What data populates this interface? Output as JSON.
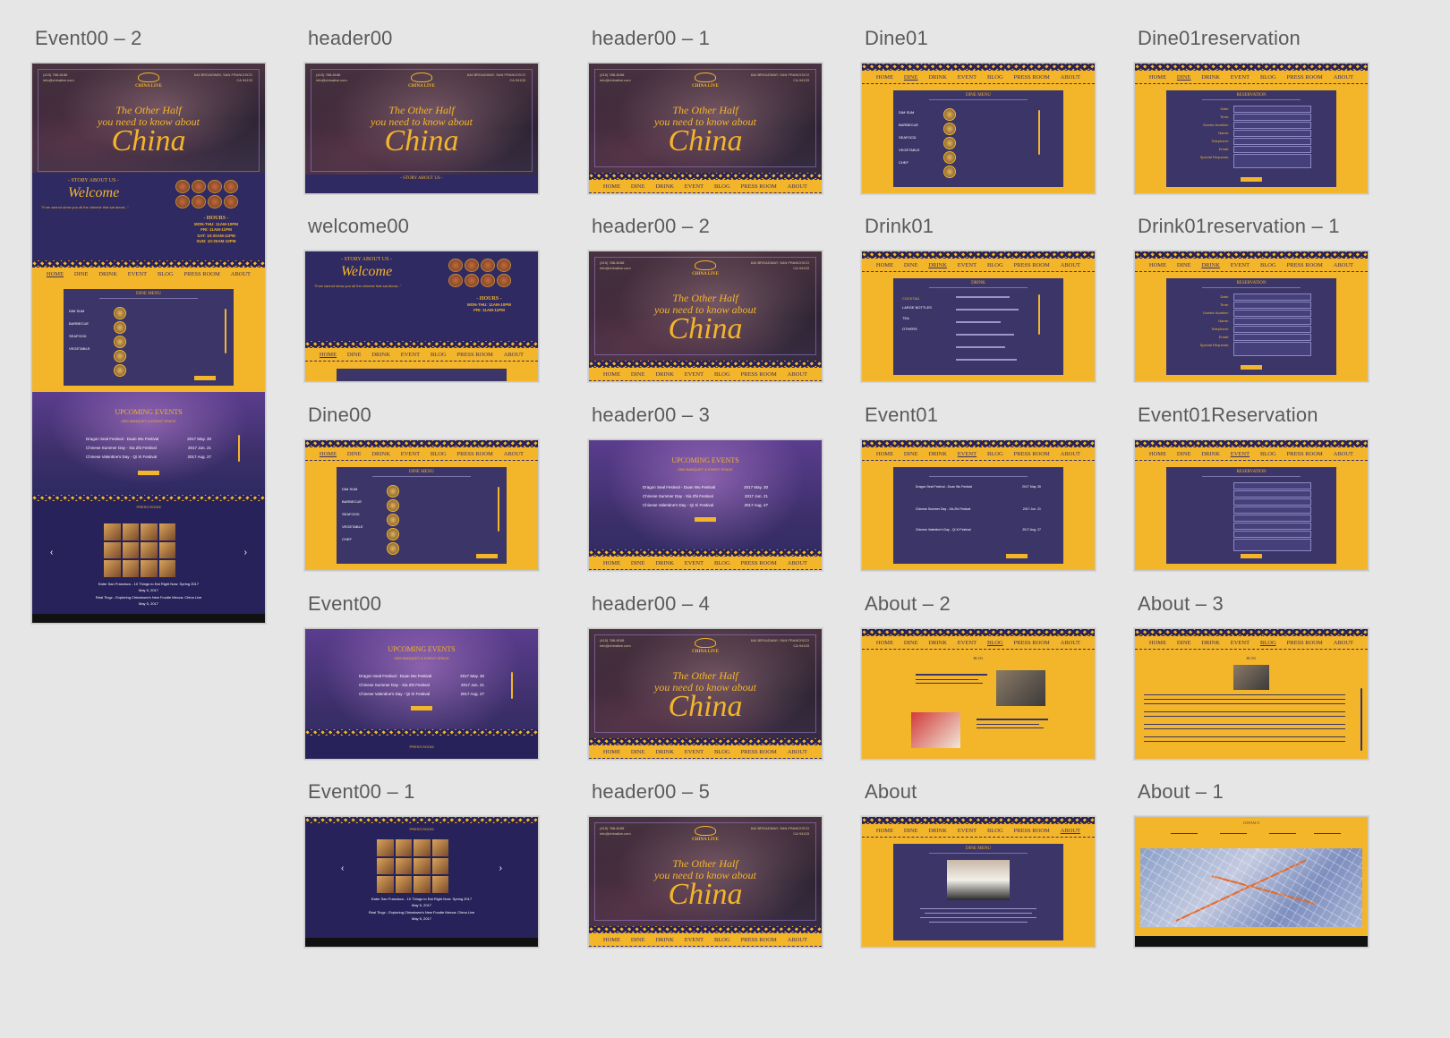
{
  "artboards": {
    "event00_2": "Event00 – 2",
    "header00": "header00",
    "header00_1": "header00 – 1",
    "dine01": "Dine01",
    "dine01reservation": "Dine01reservation",
    "welcome00": "welcome00",
    "header00_2": "header00 – 2",
    "drink01": "Drink01",
    "drink01reservation_1": "Drink01reservation – 1",
    "dine00": "Dine00",
    "header00_3": "header00 – 3",
    "event01": "Event01",
    "event01reservation": "Event01Reservation",
    "event00": "Event00",
    "header00_4": "header00 – 4",
    "about_2": "About – 2",
    "about_3": "About – 3",
    "event00_1": "Event00 – 1",
    "header00_5": "header00 – 5",
    "about": "About",
    "about_1": "About – 1"
  },
  "nav": [
    "HOME",
    "DINE",
    "DRINK",
    "EVENT",
    "BLOG",
    "PRESS ROOM",
    "ABOUT"
  ],
  "hero": {
    "brand": "CHINA LIVE",
    "tagline1": "The Other Half",
    "tagline2": "you need to know about",
    "china": "China",
    "contact_left1": "(415) 788-8188",
    "contact_left2": "info@chinalive.com",
    "contact_right1": "644 BROADWAY, SAN FRANCISCO",
    "contact_right2": "CA 94133"
  },
  "welcome": {
    "story": "- STORY ABOUT US -",
    "title": "Welcome",
    "para": "\"If we cannot show you all the chinese that sat about...\"",
    "hours_title": "- HOURS -",
    "hours": [
      "MON-THU: 11AM-10PM",
      "FRI: 11AM-11PM",
      "SAT: 10:30AM-11PM",
      "SUN: 10:30AM-10PM"
    ]
  },
  "dine": {
    "title": "DINE MENU",
    "categories": [
      "DIM SUM",
      "BARBECUE",
      "SEAFOOD",
      "VEGETABLE",
      "CHEF"
    ],
    "button": "RESERVATION"
  },
  "drink": {
    "title": "DRINK",
    "categories": [
      "COCKTAIL",
      "LARGE BOTTLES",
      "TEA",
      "OTHERS"
    ]
  },
  "reservation": {
    "title": "RESERVATION",
    "fields": [
      "Date:",
      "Time:",
      "Guests Number:",
      "Name:",
      "Telephone:",
      "Email:",
      "Special Requests:"
    ]
  },
  "events": {
    "title": "UPCOMING EVENTS",
    "sub": "GBS BANQUET & EVENT SPACE",
    "rows": [
      {
        "name": "Dragon Seal Festival - Duan Wu Festival",
        "date": "2017 May. 30"
      },
      {
        "name": "Chinese Summer Day - Xia Zhi Festival",
        "date": "2017 Jun. 21"
      },
      {
        "name": "Chinese Valentine's Day - Qi Xi Festival",
        "date": "2017 Aug. 27"
      }
    ],
    "button": "MORE"
  },
  "press": {
    "title": "PRESS ROOM",
    "cap1": "Eater San Francisco - 10 Things to Eat Right Now: Spring 2017",
    "cap1_date": "May 5, 2017",
    "cap2": "Real Tingz - Exploring Chinatown's New Foodie Mecca: China Live",
    "cap2_date": "May 5, 2017"
  },
  "blog": {
    "title": "BLOG"
  },
  "about": {
    "title": "DINE MENU"
  },
  "contact": {
    "title": "CONTACT"
  },
  "colors": {
    "gold": "#f3b52a",
    "purple": "#3b3568",
    "navy": "#27225a",
    "canvas": "#e6e6e6"
  }
}
